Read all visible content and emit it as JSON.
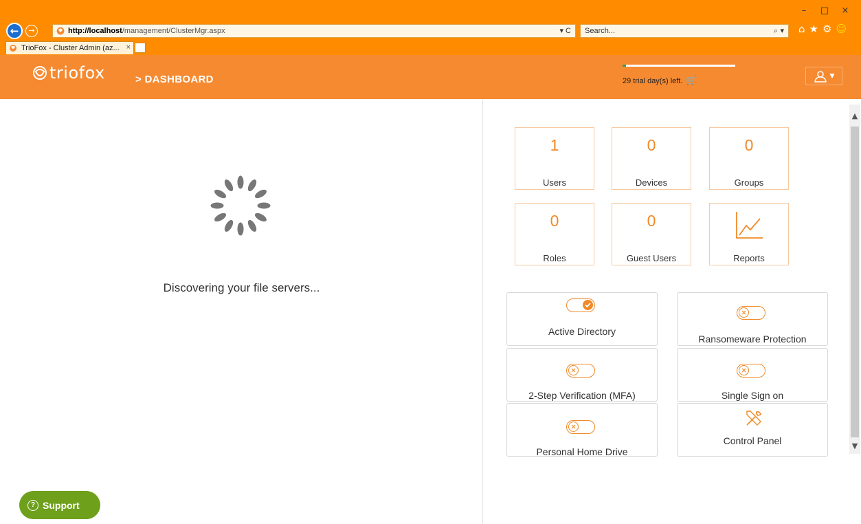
{
  "browser": {
    "url_host": "http://localhost",
    "url_path": "/management/ClusterMgr.aspx",
    "addr_tools": "▾ C",
    "search_placeholder": "Search...",
    "tab_title": "TrioFox - Cluster Admin (az...",
    "tab_close": "×",
    "window_controls": [
      "–",
      "□",
      "×"
    ]
  },
  "header": {
    "logo_text": "triofox",
    "breadcrumb": "> DASHBOARD",
    "trial_text": "29 trial day(s) left.",
    "trial_progress": 0.03,
    "brand_color": "#f58a31"
  },
  "left": {
    "status_text": "Discovering your file servers...",
    "support_label": "Support"
  },
  "stats": [
    {
      "value": "1",
      "label": "Users"
    },
    {
      "value": "0",
      "label": "Devices"
    },
    {
      "value": "0",
      "label": "Groups"
    },
    {
      "value": "0",
      "label": "Roles"
    },
    {
      "value": "0",
      "label": "Guest Users"
    },
    {
      "value": "",
      "label": "Reports",
      "icon": "chart-line-icon"
    }
  ],
  "features": [
    {
      "label": "Active Directory",
      "state": "on"
    },
    {
      "label": "Ransomeware Protection",
      "state": "off"
    },
    {
      "label": "2-Step Verification (MFA)",
      "state": "off"
    },
    {
      "label": "Single Sign on",
      "state": "off"
    },
    {
      "label": "Personal Home Drive",
      "state": "off"
    },
    {
      "label": "Control Panel",
      "icon": "tools-icon"
    }
  ],
  "colors": {
    "accent": "#f08a2a",
    "support": "#6ea01c",
    "trial_fill": "#2da44e"
  }
}
